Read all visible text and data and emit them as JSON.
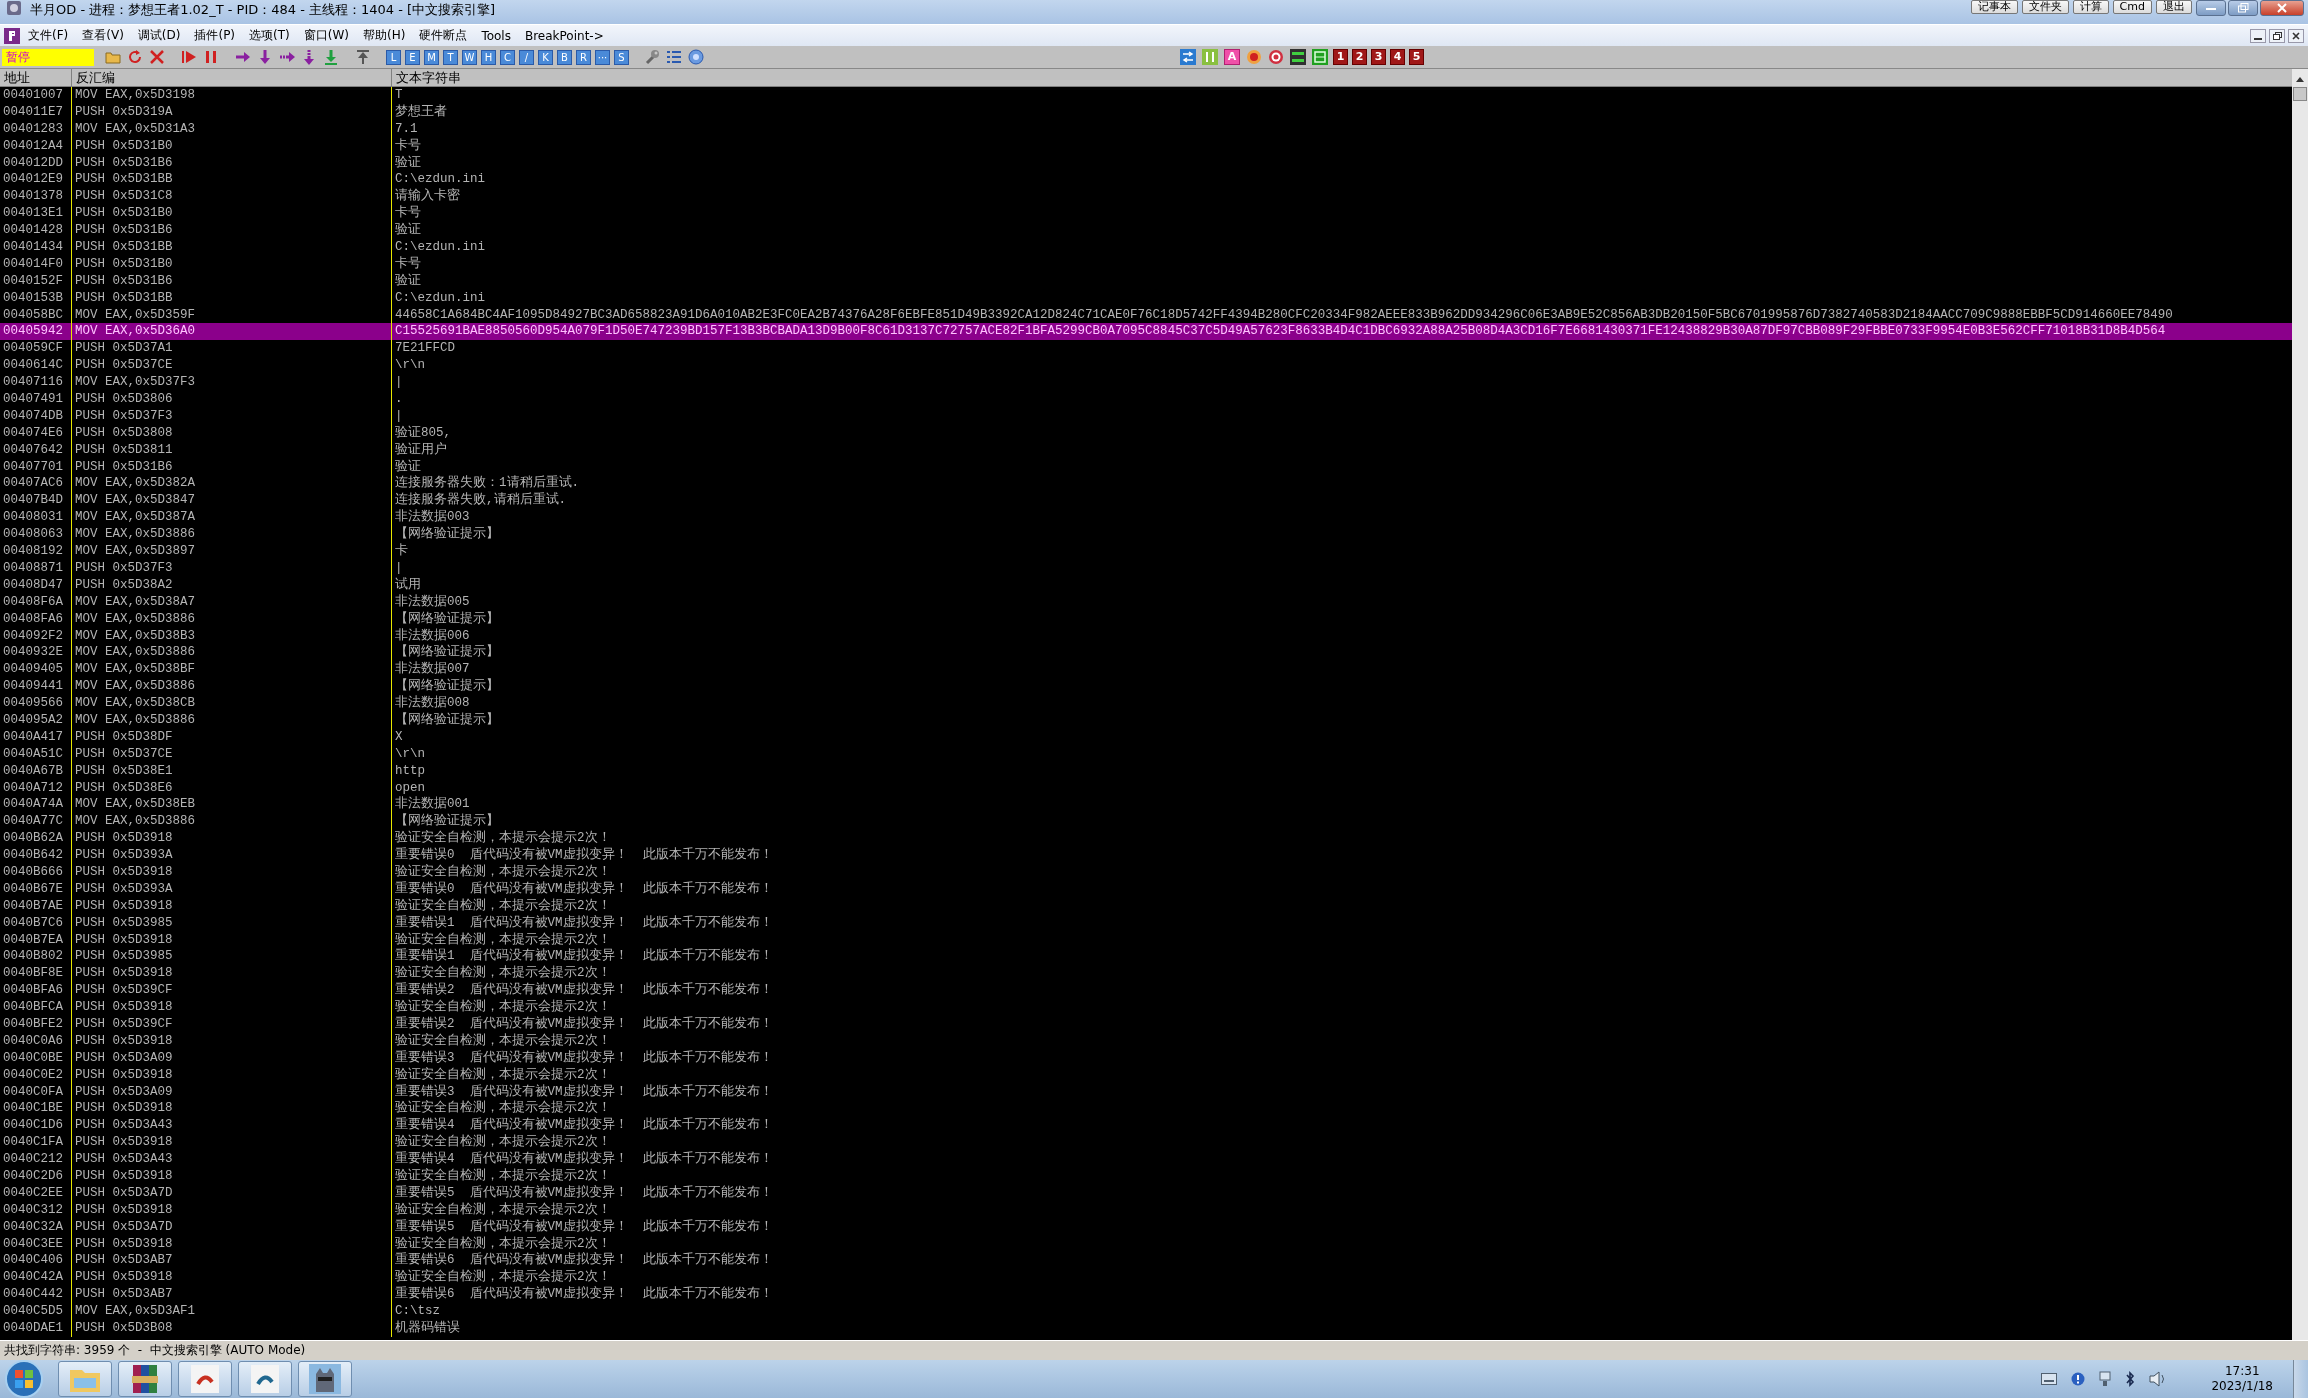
{
  "window": {
    "title": "半月OD - 进程：梦想王者1.02_T - PID：484 - 主线程：1404 - [中文搜索引擎]"
  },
  "quick_buttons": [
    "记事本",
    "文件夹",
    "计算",
    "Cmd",
    "退出"
  ],
  "menu": [
    "文件(F)",
    "查看(V)",
    "调试(D)",
    "插件(P)",
    "选项(T)",
    "窗口(W)",
    "帮助(H)",
    "硬件断点",
    "Tools",
    "BreakPoint->"
  ],
  "toolbar": {
    "status": "暂停",
    "letter_buttons": [
      "L",
      "E",
      "M",
      "T",
      "W",
      "H",
      "C",
      "/",
      "K",
      "B",
      "R",
      "···",
      "S"
    ],
    "marker_button": "A",
    "number_buttons": [
      "1",
      "2",
      "3",
      "4",
      "5"
    ]
  },
  "columns": [
    "地址",
    "反汇编",
    "文本字符串"
  ],
  "rows": [
    {
      "address": "00401007",
      "disasm": "MOV EAX,0x5D3198",
      "text": "T",
      "selected": false
    },
    {
      "address": "004011E7",
      "disasm": "PUSH 0x5D319A",
      "text": "梦想王者",
      "selected": false
    },
    {
      "address": "00401283",
      "disasm": "MOV EAX,0x5D31A3",
      "text": "7.1",
      "selected": false
    },
    {
      "address": "004012A4",
      "disasm": "PUSH 0x5D31B0",
      "text": "卡号",
      "selected": false
    },
    {
      "address": "004012DD",
      "disasm": "PUSH 0x5D31B6",
      "text": "验证",
      "selected": false
    },
    {
      "address": "004012E9",
      "disasm": "PUSH 0x5D31BB",
      "text": "C:\\ezdun.ini",
      "selected": false
    },
    {
      "address": "00401378",
      "disasm": "PUSH 0x5D31C8",
      "text": "请输入卡密",
      "selected": false
    },
    {
      "address": "004013E1",
      "disasm": "PUSH 0x5D31B0",
      "text": "卡号",
      "selected": false
    },
    {
      "address": "00401428",
      "disasm": "PUSH 0x5D31B6",
      "text": "验证",
      "selected": false
    },
    {
      "address": "00401434",
      "disasm": "PUSH 0x5D31BB",
      "text": "C:\\ezdun.ini",
      "selected": false
    },
    {
      "address": "004014F0",
      "disasm": "PUSH 0x5D31B0",
      "text": "卡号",
      "selected": false
    },
    {
      "address": "0040152F",
      "disasm": "PUSH 0x5D31B6",
      "text": "验证",
      "selected": false
    },
    {
      "address": "0040153B",
      "disasm": "PUSH 0x5D31BB",
      "text": "C:\\ezdun.ini",
      "selected": false
    },
    {
      "address": "004058BC",
      "disasm": "MOV EAX,0x5D359F",
      "text": "44658C1A684BC4AF1095D84927BC3AD658823A91D6A010AB2E3FC0EA2B74376A28F6EBFE851D49B3392CA12D824C71CAE0F76C18D5742FF4394B280CFC20334F982AEEE833B962DD934296C06E3AB9E52C856AB3DB20150F5BC6701995876D7382740583D2184AACC709C9888EBBF5CD914660EE78490",
      "selected": false
    },
    {
      "address": "00405942",
      "disasm": "MOV EAX,0x5D36A0",
      "text": "C15525691BAE8850560D954A079F1D50E747239BD157F13B3BCBADA13D9B00F8C61D3137C72757ACE82F1BFA5299CB0A7095C8845C37C5D49A57623F8633B4D4C1DBC6932A88A25B08D4A3CD16F7E6681430371FE12438829B30A87DF97CBB089F29FBBE0733F9954E0B3E562CFF71018B31D8B4D564",
      "selected": true
    },
    {
      "address": "004059CF",
      "disasm": "PUSH 0x5D37A1",
      "text": "7E21FFCD",
      "selected": false
    },
    {
      "address": "0040614C",
      "disasm": "PUSH 0x5D37CE",
      "text": "\\r\\n",
      "selected": false
    },
    {
      "address": "00407116",
      "disasm": "MOV EAX,0x5D37F3",
      "text": "|",
      "selected": false
    },
    {
      "address": "00407491",
      "disasm": "PUSH 0x5D3806",
      "text": ".",
      "selected": false
    },
    {
      "address": "004074DB",
      "disasm": "PUSH 0x5D37F3",
      "text": "|",
      "selected": false
    },
    {
      "address": "004074E6",
      "disasm": "PUSH 0x5D3808",
      "text": "验证805,",
      "selected": false
    },
    {
      "address": "00407642",
      "disasm": "PUSH 0x5D3811",
      "text": "验证用户",
      "selected": false
    },
    {
      "address": "00407701",
      "disasm": "PUSH 0x5D31B6",
      "text": "验证",
      "selected": false
    },
    {
      "address": "00407AC6",
      "disasm": "MOV EAX,0x5D382A",
      "text": "连接服务器失败：1请稍后重试.",
      "selected": false
    },
    {
      "address": "00407B4D",
      "disasm": "MOV EAX,0x5D3847",
      "text": "连接服务器失败,请稍后重试.",
      "selected": false
    },
    {
      "address": "00408031",
      "disasm": "MOV EAX,0x5D387A",
      "text": "非法数据003",
      "selected": false
    },
    {
      "address": "00408063",
      "disasm": "MOV EAX,0x5D3886",
      "text": "【网络验证提示】",
      "selected": false
    },
    {
      "address": "00408192",
      "disasm": "MOV EAX,0x5D3897",
      "text": "卡",
      "selected": false
    },
    {
      "address": "00408871",
      "disasm": "PUSH 0x5D37F3",
      "text": "|",
      "selected": false
    },
    {
      "address": "00408D47",
      "disasm": "PUSH 0x5D38A2",
      "text": "试用",
      "selected": false
    },
    {
      "address": "00408F6A",
      "disasm": "MOV EAX,0x5D38A7",
      "text": "非法数据005",
      "selected": false
    },
    {
      "address": "00408FA6",
      "disasm": "MOV EAX,0x5D3886",
      "text": "【网络验证提示】",
      "selected": false
    },
    {
      "address": "004092F2",
      "disasm": "MOV EAX,0x5D38B3",
      "text": "非法数据006",
      "selected": false
    },
    {
      "address": "0040932E",
      "disasm": "MOV EAX,0x5D3886",
      "text": "【网络验证提示】",
      "selected": false
    },
    {
      "address": "00409405",
      "disasm": "MOV EAX,0x5D38BF",
      "text": "非法数据007",
      "selected": false
    },
    {
      "address": "00409441",
      "disasm": "MOV EAX,0x5D3886",
      "text": "【网络验证提示】",
      "selected": false
    },
    {
      "address": "00409566",
      "disasm": "MOV EAX,0x5D38CB",
      "text": "非法数据008",
      "selected": false
    },
    {
      "address": "004095A2",
      "disasm": "MOV EAX,0x5D3886",
      "text": "【网络验证提示】",
      "selected": false
    },
    {
      "address": "0040A417",
      "disasm": "PUSH 0x5D38DF",
      "text": "X",
      "selected": false
    },
    {
      "address": "0040A51C",
      "disasm": "PUSH 0x5D37CE",
      "text": "\\r\\n",
      "selected": false
    },
    {
      "address": "0040A67B",
      "disasm": "PUSH 0x5D38E1",
      "text": "http",
      "selected": false
    },
    {
      "address": "0040A712",
      "disasm": "PUSH 0x5D38E6",
      "text": "open",
      "selected": false
    },
    {
      "address": "0040A74A",
      "disasm": "MOV EAX,0x5D38EB",
      "text": "非法数据001",
      "selected": false
    },
    {
      "address": "0040A77C",
      "disasm": "MOV EAX,0x5D3886",
      "text": "【网络验证提示】",
      "selected": false
    },
    {
      "address": "0040B62A",
      "disasm": "PUSH 0x5D3918",
      "text": "验证安全自检测，本提示会提示2次！",
      "selected": false
    },
    {
      "address": "0040B642",
      "disasm": "PUSH 0x5D393A",
      "text": "重要错误0  盾代码没有被VM虚拟变异！  此版本千万不能发布！",
      "selected": false
    },
    {
      "address": "0040B666",
      "disasm": "PUSH 0x5D3918",
      "text": "验证安全自检测，本提示会提示2次！",
      "selected": false
    },
    {
      "address": "0040B67E",
      "disasm": "PUSH 0x5D393A",
      "text": "重要错误0  盾代码没有被VM虚拟变异！  此版本千万不能发布！",
      "selected": false
    },
    {
      "address": "0040B7AE",
      "disasm": "PUSH 0x5D3918",
      "text": "验证安全自检测，本提示会提示2次！",
      "selected": false
    },
    {
      "address": "0040B7C6",
      "disasm": "PUSH 0x5D3985",
      "text": "重要错误1  盾代码没有被VM虚拟变异！  此版本千万不能发布！",
      "selected": false
    },
    {
      "address": "0040B7EA",
      "disasm": "PUSH 0x5D3918",
      "text": "验证安全自检测，本提示会提示2次！",
      "selected": false
    },
    {
      "address": "0040B802",
      "disasm": "PUSH 0x5D3985",
      "text": "重要错误1  盾代码没有被VM虚拟变异！  此版本千万不能发布！",
      "selected": false
    },
    {
      "address": "0040BF8E",
      "disasm": "PUSH 0x5D3918",
      "text": "验证安全自检测，本提示会提示2次！",
      "selected": false
    },
    {
      "address": "0040BFA6",
      "disasm": "PUSH 0x5D39CF",
      "text": "重要错误2  盾代码没有被VM虚拟变异！  此版本千万不能发布！",
      "selected": false
    },
    {
      "address": "0040BFCA",
      "disasm": "PUSH 0x5D3918",
      "text": "验证安全自检测，本提示会提示2次！",
      "selected": false
    },
    {
      "address": "0040BFE2",
      "disasm": "PUSH 0x5D39CF",
      "text": "重要错误2  盾代码没有被VM虚拟变异！  此版本千万不能发布！",
      "selected": false
    },
    {
      "address": "0040C0A6",
      "disasm": "PUSH 0x5D3918",
      "text": "验证安全自检测，本提示会提示2次！",
      "selected": false
    },
    {
      "address": "0040C0BE",
      "disasm": "PUSH 0x5D3A09",
      "text": "重要错误3  盾代码没有被VM虚拟变异！  此版本千万不能发布！",
      "selected": false
    },
    {
      "address": "0040C0E2",
      "disasm": "PUSH 0x5D3918",
      "text": "验证安全自检测，本提示会提示2次！",
      "selected": false
    },
    {
      "address": "0040C0FA",
      "disasm": "PUSH 0x5D3A09",
      "text": "重要错误3  盾代码没有被VM虚拟变异！  此版本千万不能发布！",
      "selected": false
    },
    {
      "address": "0040C1BE",
      "disasm": "PUSH 0x5D3918",
      "text": "验证安全自检测，本提示会提示2次！",
      "selected": false
    },
    {
      "address": "0040C1D6",
      "disasm": "PUSH 0x5D3A43",
      "text": "重要错误4  盾代码没有被VM虚拟变异！  此版本千万不能发布！",
      "selected": false
    },
    {
      "address": "0040C1FA",
      "disasm": "PUSH 0x5D3918",
      "text": "验证安全自检测，本提示会提示2次！",
      "selected": false
    },
    {
      "address": "0040C212",
      "disasm": "PUSH 0x5D3A43",
      "text": "重要错误4  盾代码没有被VM虚拟变异！  此版本千万不能发布！",
      "selected": false
    },
    {
      "address": "0040C2D6",
      "disasm": "PUSH 0x5D3918",
      "text": "验证安全自检测，本提示会提示2次！",
      "selected": false
    },
    {
      "address": "0040C2EE",
      "disasm": "PUSH 0x5D3A7D",
      "text": "重要错误5  盾代码没有被VM虚拟变异！  此版本千万不能发布！",
      "selected": false
    },
    {
      "address": "0040C312",
      "disasm": "PUSH 0x5D3918",
      "text": "验证安全自检测，本提示会提示2次！",
      "selected": false
    },
    {
      "address": "0040C32A",
      "disasm": "PUSH 0x5D3A7D",
      "text": "重要错误5  盾代码没有被VM虚拟变异！  此版本千万不能发布！",
      "selected": false
    },
    {
      "address": "0040C3EE",
      "disasm": "PUSH 0x5D3918",
      "text": "验证安全自检测，本提示会提示2次！",
      "selected": false
    },
    {
      "address": "0040C406",
      "disasm": "PUSH 0x5D3AB7",
      "text": "重要错误6  盾代码没有被VM虚拟变异！  此版本千万不能发布！",
      "selected": false
    },
    {
      "address": "0040C42A",
      "disasm": "PUSH 0x5D3918",
      "text": "验证安全自检测，本提示会提示2次！",
      "selected": false
    },
    {
      "address": "0040C442",
      "disasm": "PUSH 0x5D3AB7",
      "text": "重要错误6  盾代码没有被VM虚拟变异！  此版本千万不能发布！",
      "selected": false
    },
    {
      "address": "0040C5D5",
      "disasm": "MOV EAX,0x5D3AF1",
      "text": "C:\\tsz",
      "selected": false
    },
    {
      "address": "0040DAE1",
      "disasm": "PUSH 0x5D3B08",
      "text": "机器码错误",
      "selected": false
    }
  ],
  "status_bar": "共找到字符串: 3959 个  -  中文搜索引擎 (AUTO Mode)",
  "taskbar": {
    "time": "17:31",
    "date": "2023/1/18"
  }
}
